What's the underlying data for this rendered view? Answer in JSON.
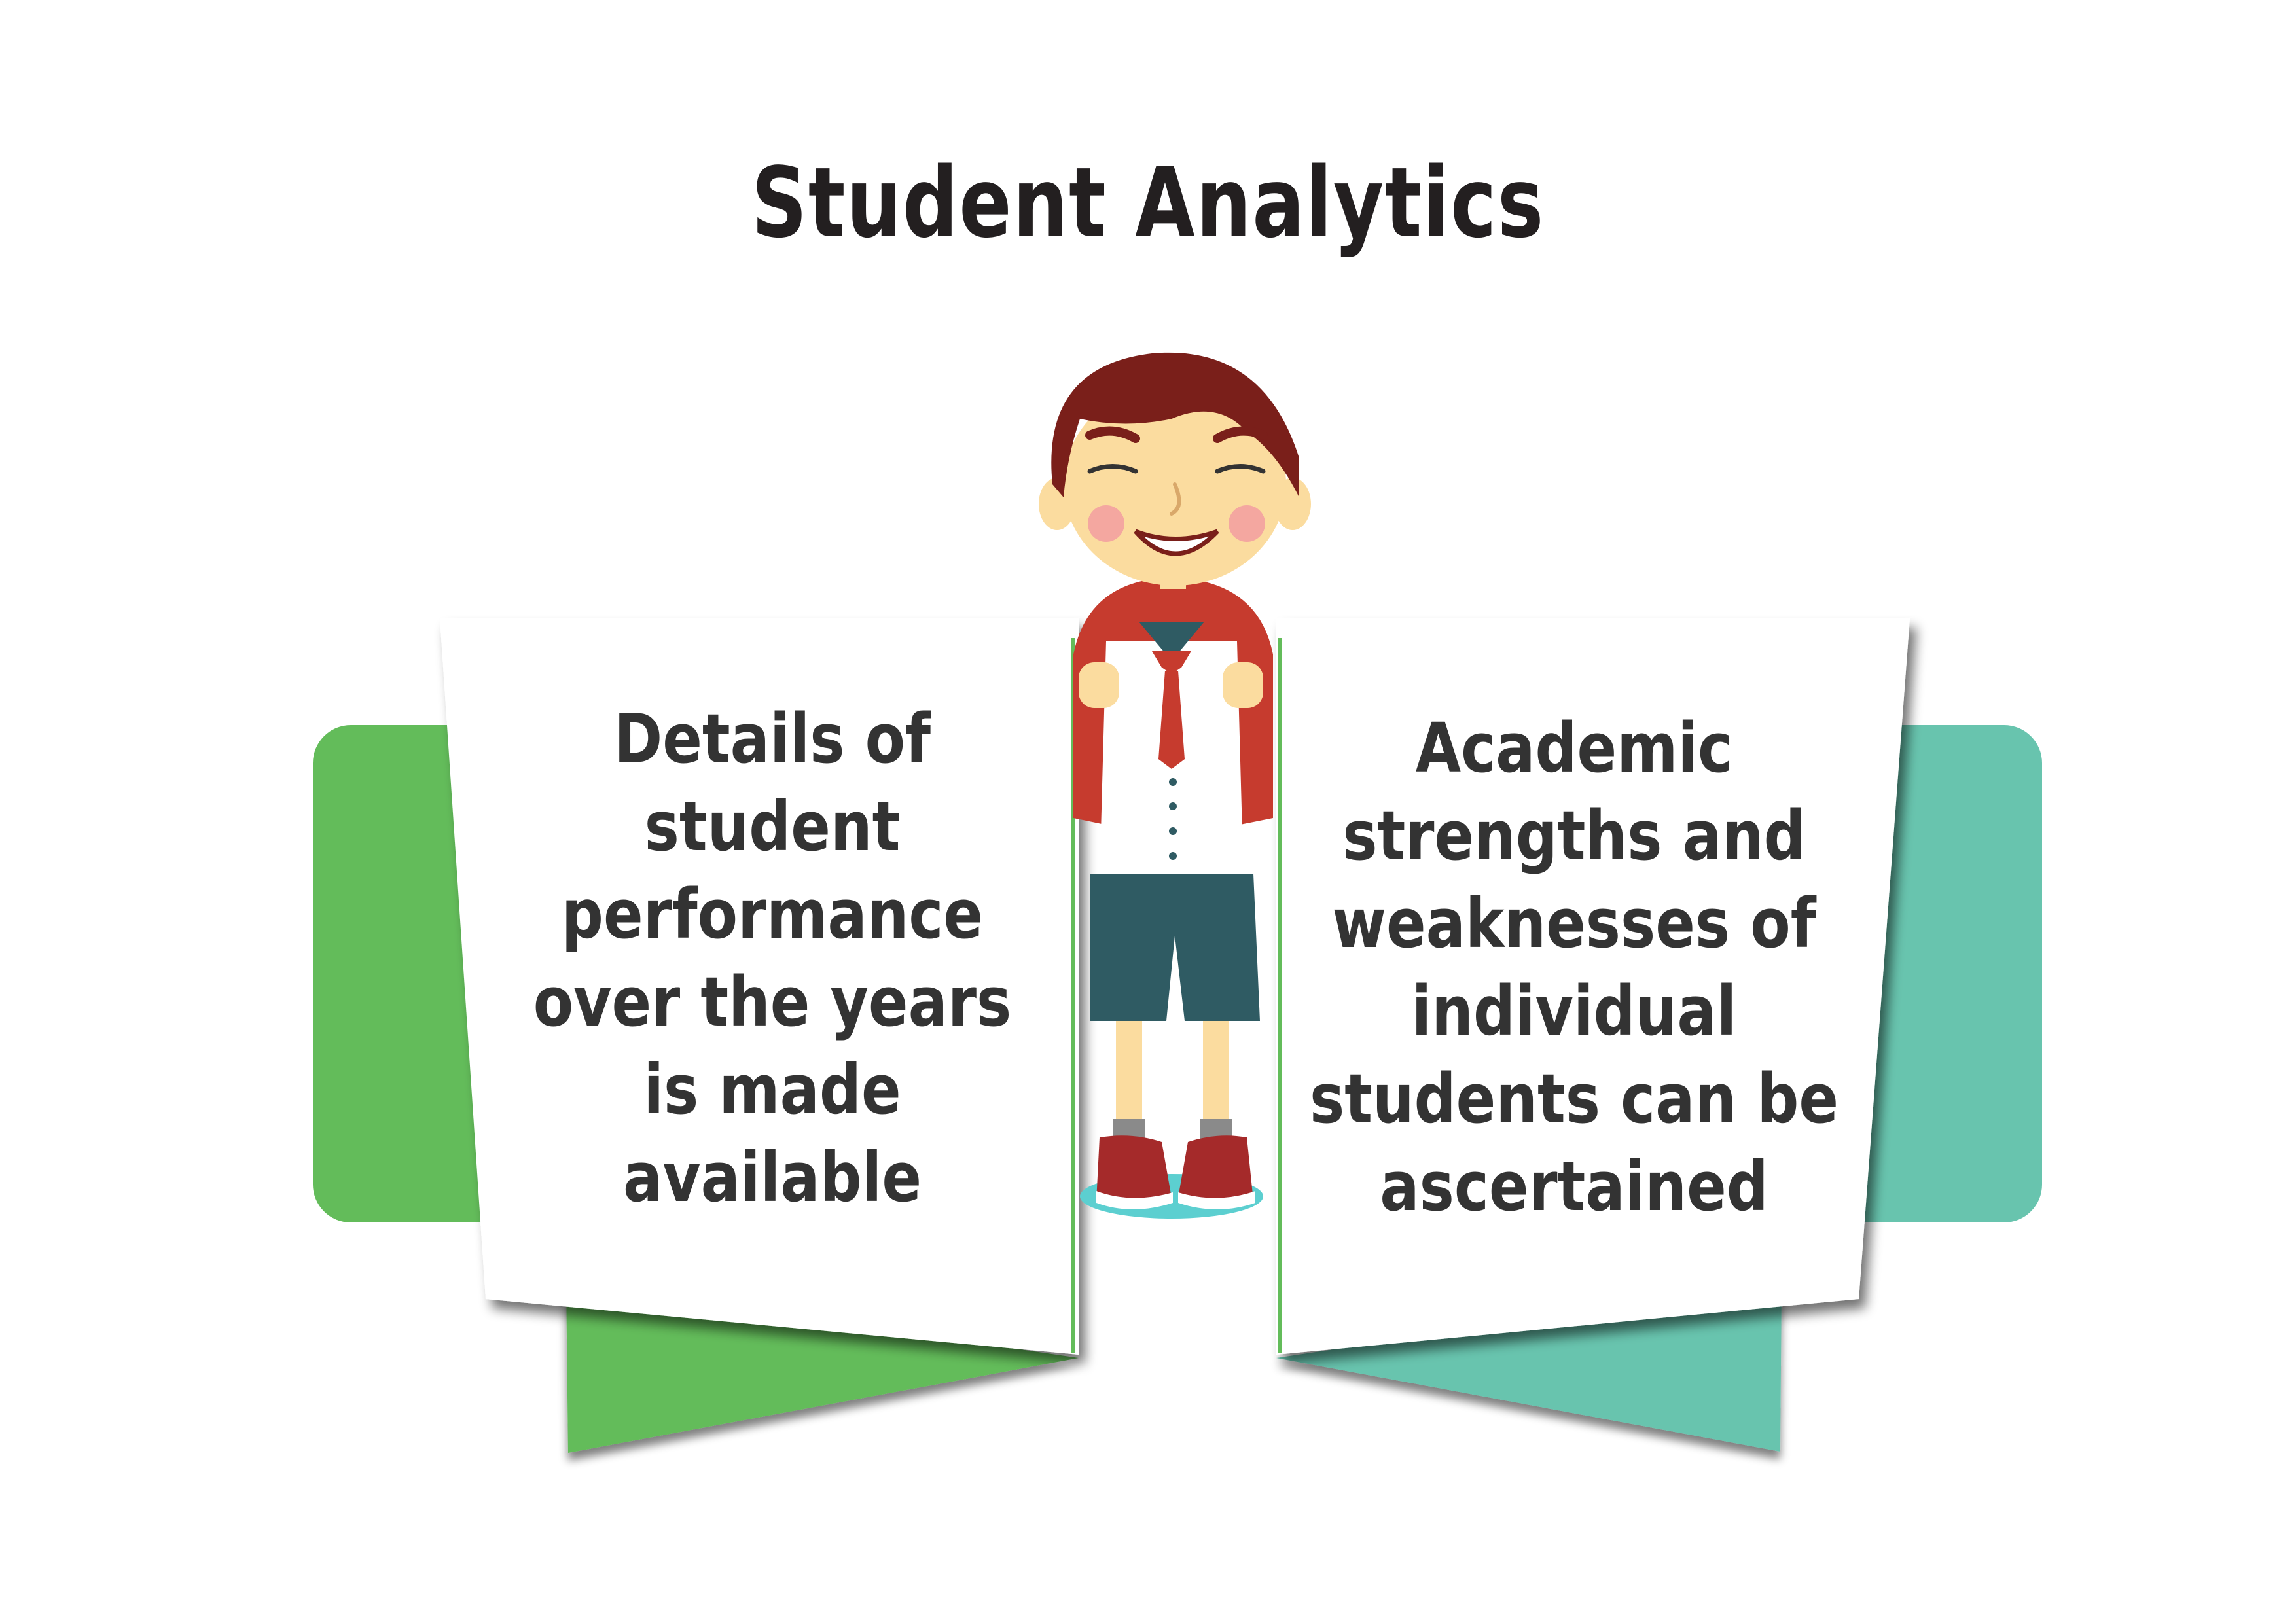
{
  "title": "Student Analytics",
  "left_panel": {
    "lines": [
      "Details of",
      "student",
      "performance",
      "over the years",
      "is made",
      "available"
    ]
  },
  "right_panel": {
    "lines": [
      "Academic",
      "strengths and",
      "weaknesses of",
      "individual",
      "students can be",
      "ascertained"
    ]
  },
  "colors": {
    "left_accent": "#63bc5a",
    "right_accent": "#68c4ae",
    "text": "#333333",
    "title": "#231f20",
    "hair": "#7a1f1a",
    "shirt_red": "#c63b2e",
    "shorts": "#2f5b63",
    "skin": "#fbdc9f",
    "floor": "#5ccfd0"
  },
  "illustration": {
    "icon": "student-boy-icon"
  }
}
